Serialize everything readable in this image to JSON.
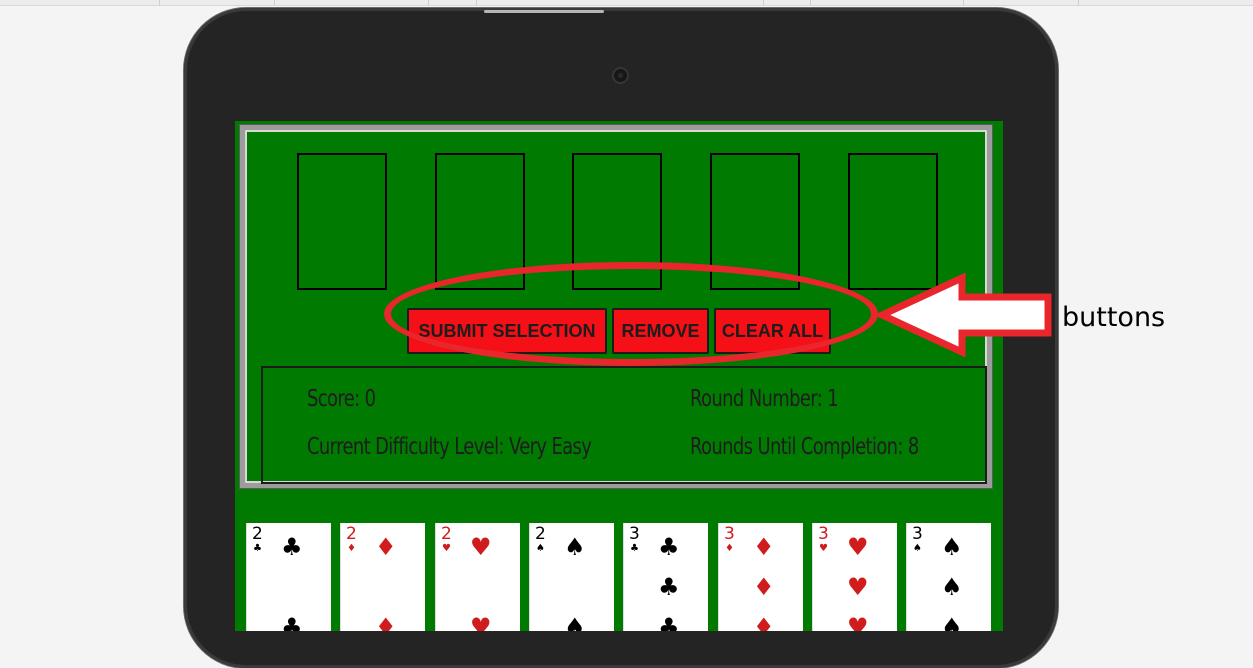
{
  "annotation": {
    "label": "buttons",
    "color": "#e8262c"
  },
  "icons": {
    "camera": "camera-lens-icon"
  },
  "colors": {
    "felt": "#007a00",
    "button": "#f50f16",
    "bezel": "#242424"
  },
  "game": {
    "slots_count": 5,
    "buttons": {
      "submit": "SUBMIT SELECTION",
      "remove": "REMOVE",
      "clear": "CLEAR ALL"
    },
    "stats": {
      "score": "Score: 0",
      "round": "Round Number: 1",
      "difficulty": "Current Difficulty Level: Very Easy",
      "rounds_left": "Rounds Until Completion: 8"
    },
    "hand": [
      {
        "rank": "2",
        "suit": "♣",
        "color": "#000000"
      },
      {
        "rank": "2",
        "suit": "♦",
        "color": "#d01c1c"
      },
      {
        "rank": "2",
        "suit": "♥",
        "color": "#d01c1c"
      },
      {
        "rank": "2",
        "suit": "♠",
        "color": "#000000"
      },
      {
        "rank": "3",
        "suit": "♣",
        "color": "#000000"
      },
      {
        "rank": "3",
        "suit": "♦",
        "color": "#d01c1c"
      },
      {
        "rank": "3",
        "suit": "♥",
        "color": "#d01c1c"
      },
      {
        "rank": "3",
        "suit": "♠",
        "color": "#000000"
      }
    ]
  }
}
